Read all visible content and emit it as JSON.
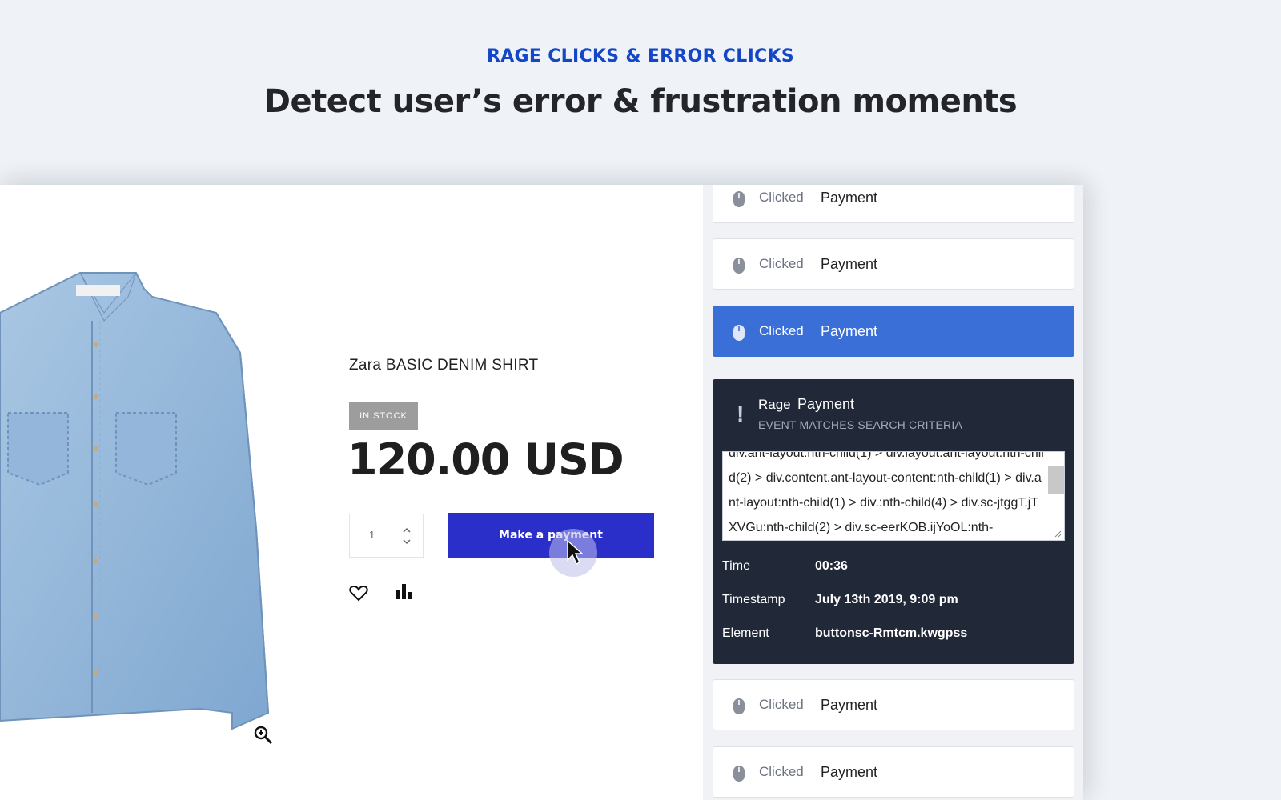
{
  "hero": {
    "eyebrow": "RAGE CLICKS & ERROR CLICKS",
    "title": "Detect user’s error & frustration moments"
  },
  "product": {
    "name": "Zara BASIC DENIM SHIRT",
    "stock_badge": "IN STOCK",
    "price": "120.00 USD",
    "quantity": "1",
    "pay_button": "Make a payment"
  },
  "events": [
    {
      "kind": "Clicked",
      "target": "Payment",
      "state": "normal"
    },
    {
      "kind": "Clicked",
      "target": "Payment",
      "state": "normal"
    },
    {
      "kind": "Clicked",
      "target": "Payment",
      "state": "active"
    },
    {
      "kind": "Clicked",
      "target": "Payment",
      "state": "normal"
    },
    {
      "kind": "Clicked",
      "target": "Payment",
      "state": "normal"
    }
  ],
  "rage_event": {
    "kind": "Rage",
    "target": "Payment",
    "subtitle": "EVENT MATCHES SEARCH CRITERIA",
    "selector": "div.ant-layout:nth-child(1) > div.layout.ant-layout:nth-child(2) > div.content.ant-layout-content:nth-child(1) > div.ant-layout:nth-child(1) > div.:nth-child(4) > div.sc-jtggT.jTXVGu:nth-child(2) > div.sc-eerKOB.ijYoOL:nth-",
    "time_label": "Time",
    "time_value": "00:36",
    "timestamp_label": "Timestamp",
    "timestamp_value": "July 13th 2019, 9:09 pm",
    "element_label": "Element",
    "element_value": "buttonsc-Rmtcm.kwgpss"
  },
  "colors": {
    "accent_blue": "#1446c7",
    "pay_button": "#2b2fc9",
    "active_event": "#3a6fd8",
    "rage_card": "#212838"
  },
  "icons": [
    "mouse-icon",
    "alert-icon",
    "heart-icon",
    "bar-chart-icon",
    "zoom-in-icon",
    "cursor-icon"
  ]
}
